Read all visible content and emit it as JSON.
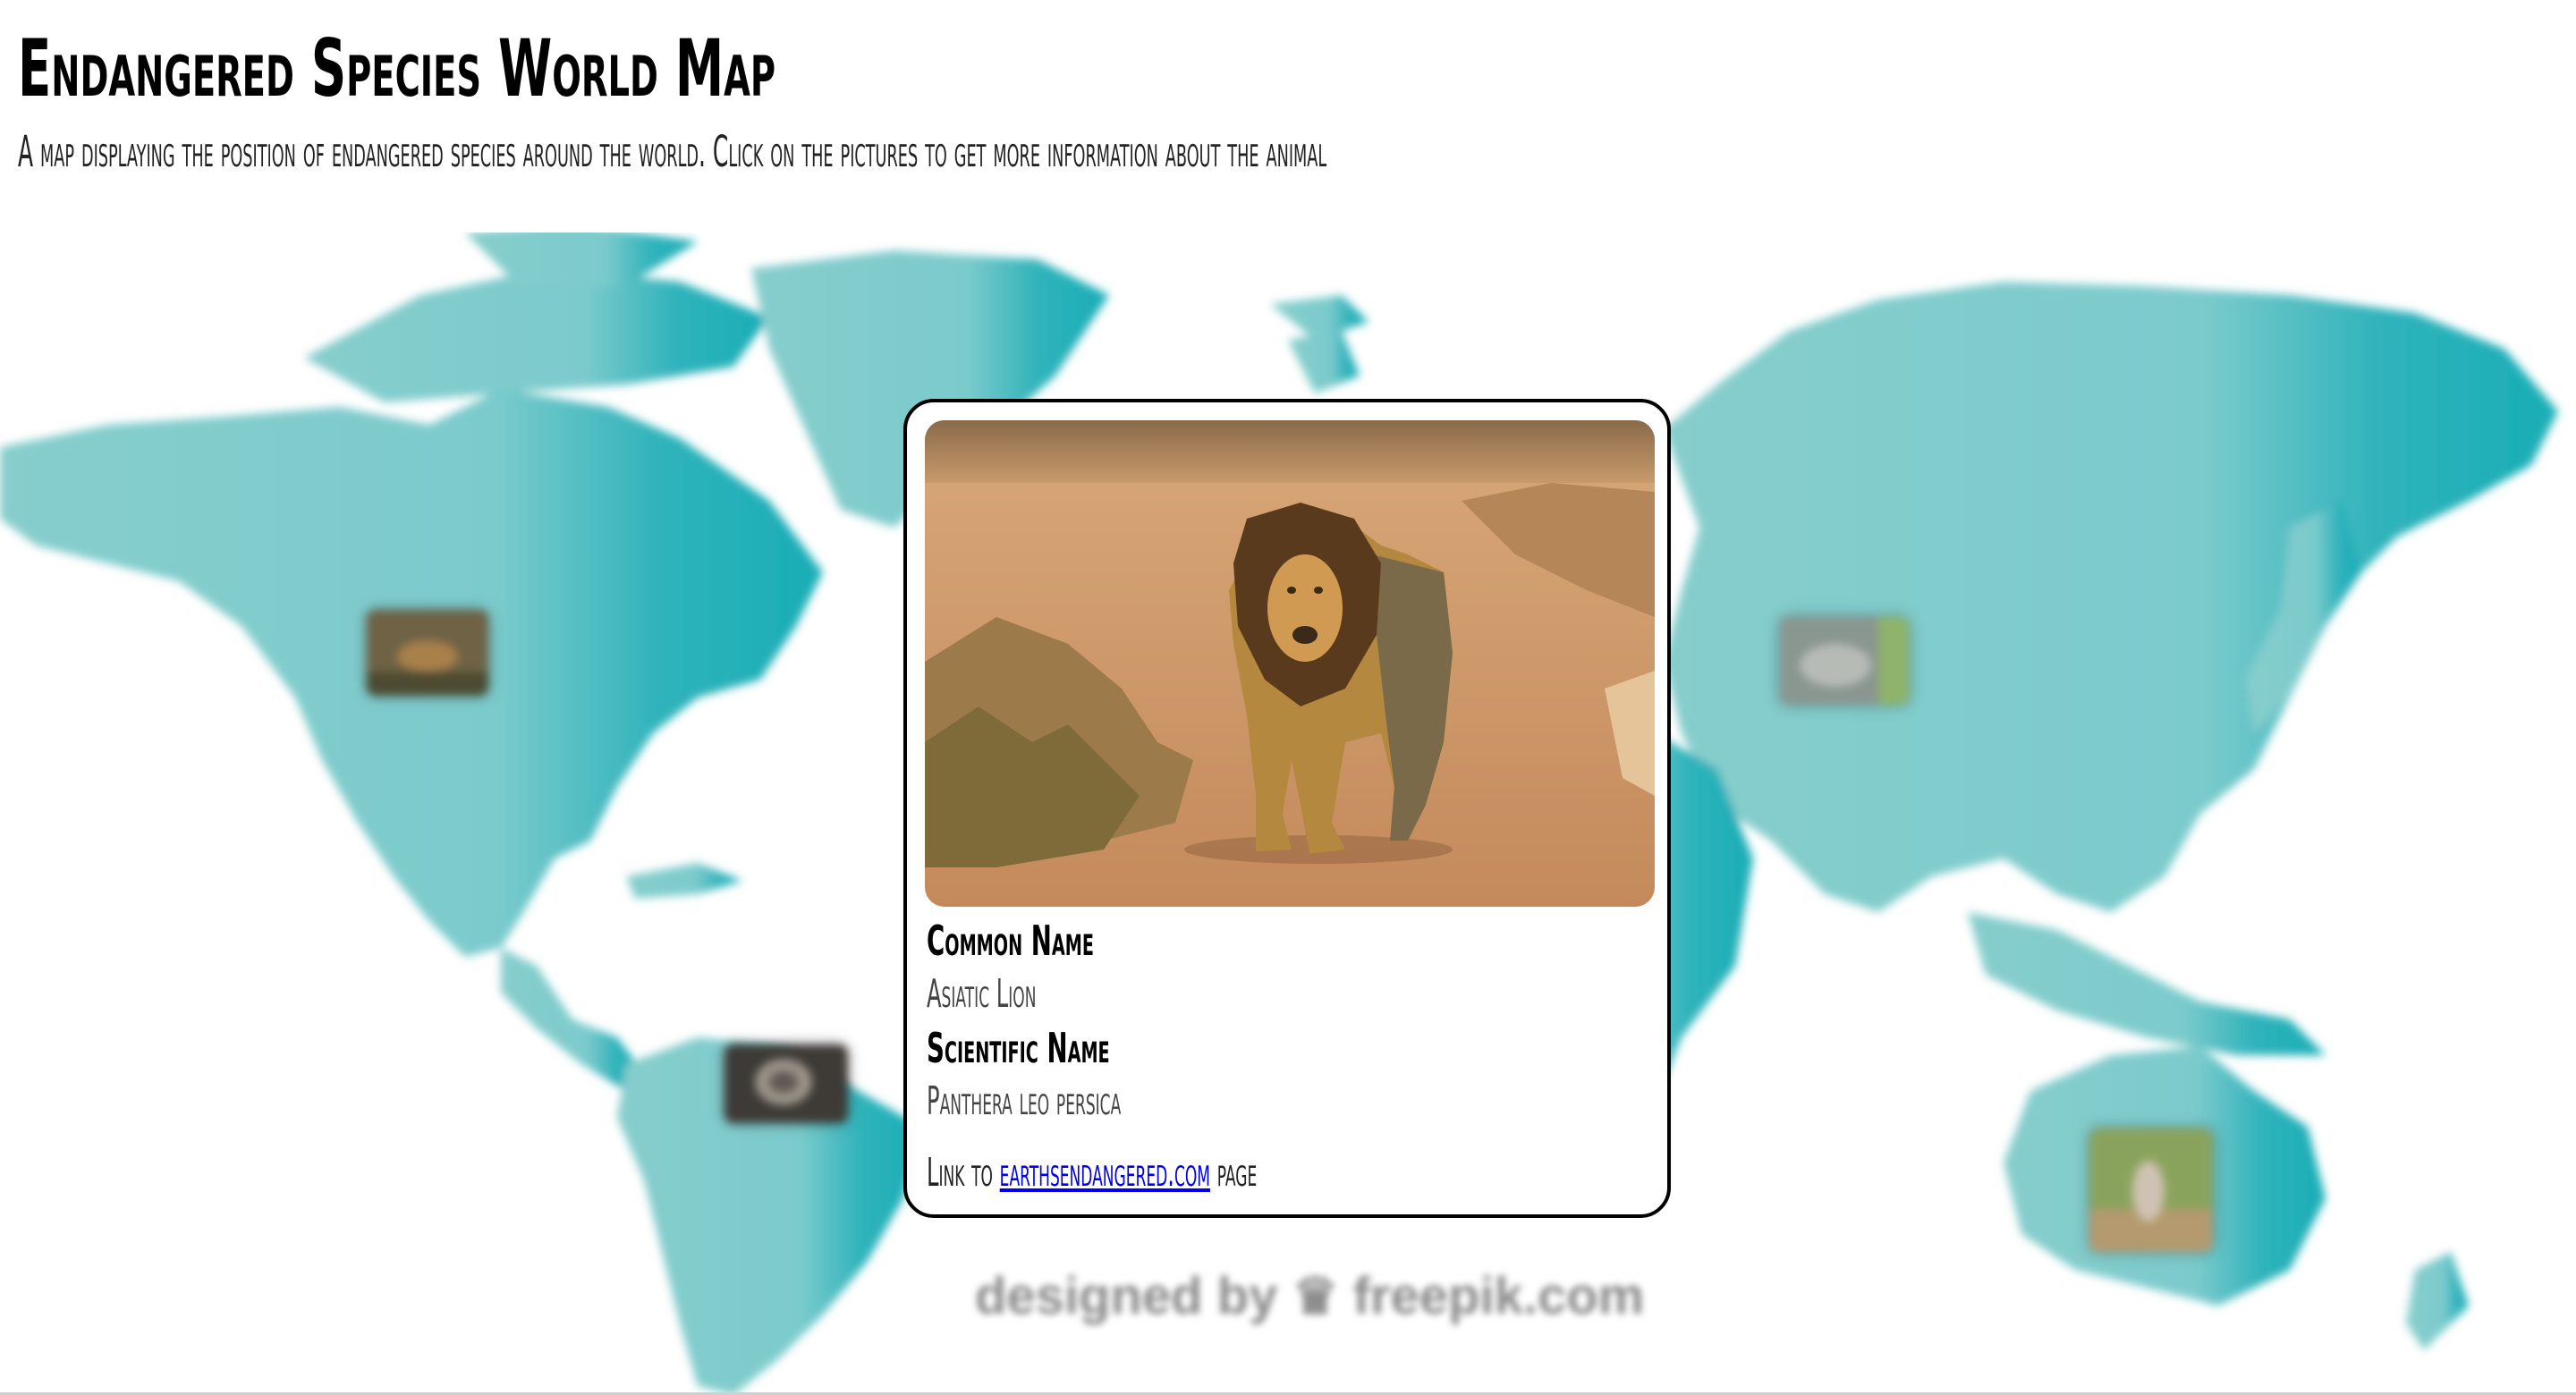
{
  "page": {
    "title": "Endangered Species World Map",
    "subtitle": "A map displaying the position of endangered species around the world. Click on the pictures to get more information about the animal"
  },
  "map": {
    "colors": {
      "land_light": "#86cdcc",
      "land_dark": "#19adb6"
    },
    "markers": [
      {
        "name": "north-america-animal",
        "icon": "animal-photo-thumbnail"
      },
      {
        "name": "south-america-animal",
        "icon": "animal-photo-thumbnail"
      },
      {
        "name": "asia-animal",
        "icon": "animal-photo-thumbnail"
      },
      {
        "name": "australia-animal",
        "icon": "animal-photo-thumbnail"
      }
    ],
    "watermark": "designed by ♛ freepik.com"
  },
  "card": {
    "photo_icon": "asiatic-lion-photo",
    "common_name_label": "Common Name",
    "common_name": "Asiatic Lion",
    "scientific_name_label": "Scientific Name",
    "scientific_name": "Panthera leo persica",
    "link_prefix": "Link to",
    "link_text": "earthsendangered.com",
    "link_suffix": "page"
  }
}
